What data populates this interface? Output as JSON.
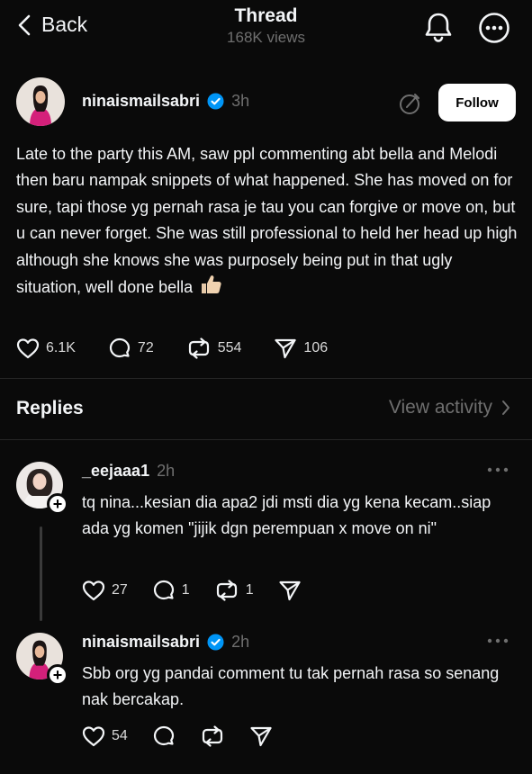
{
  "header": {
    "back_label": "Back",
    "title": "Thread",
    "views": "168K views"
  },
  "post": {
    "username": "ninaismailsabri",
    "verified": true,
    "time": "3h",
    "follow_label": "Follow",
    "body": "Late to the party this AM, saw ppl commenting abt bella and Melodi then baru nampak snippets of what happened. She has moved on for sure, tapi those yg pernah rasa je tau you can forgive or move on, but u can never forget. She was still professional to held her head up high although she knows she was purposely being put in that ugly situation, well done bella",
    "emoji": "👍🏼",
    "likes": "6.1K",
    "comments": "72",
    "reposts": "554",
    "shares": "106"
  },
  "replies_section": {
    "title": "Replies",
    "view_activity": "View activity"
  },
  "replies": [
    {
      "username": "_eejaaa1",
      "time": "2h",
      "text": "tq nina...kesian dia apa2 jdi msti dia yg kena kecam..siap ada yg komen \"jijik dgn perempuan x move on ni\"",
      "likes": "27",
      "comments": "1",
      "reposts": "1"
    },
    {
      "username": "ninaismailsabri",
      "verified": true,
      "time": "2h",
      "text": "Sbb org yg pandai comment tu tak pernah rasa so senang nak bercakap.",
      "likes": "54"
    }
  ],
  "colors": {
    "background": "#0a0a0a",
    "text": "#f3f5f7",
    "muted": "#6f6f6f",
    "verified": "#0095f6",
    "avatar_outfit": "#d4207a"
  }
}
